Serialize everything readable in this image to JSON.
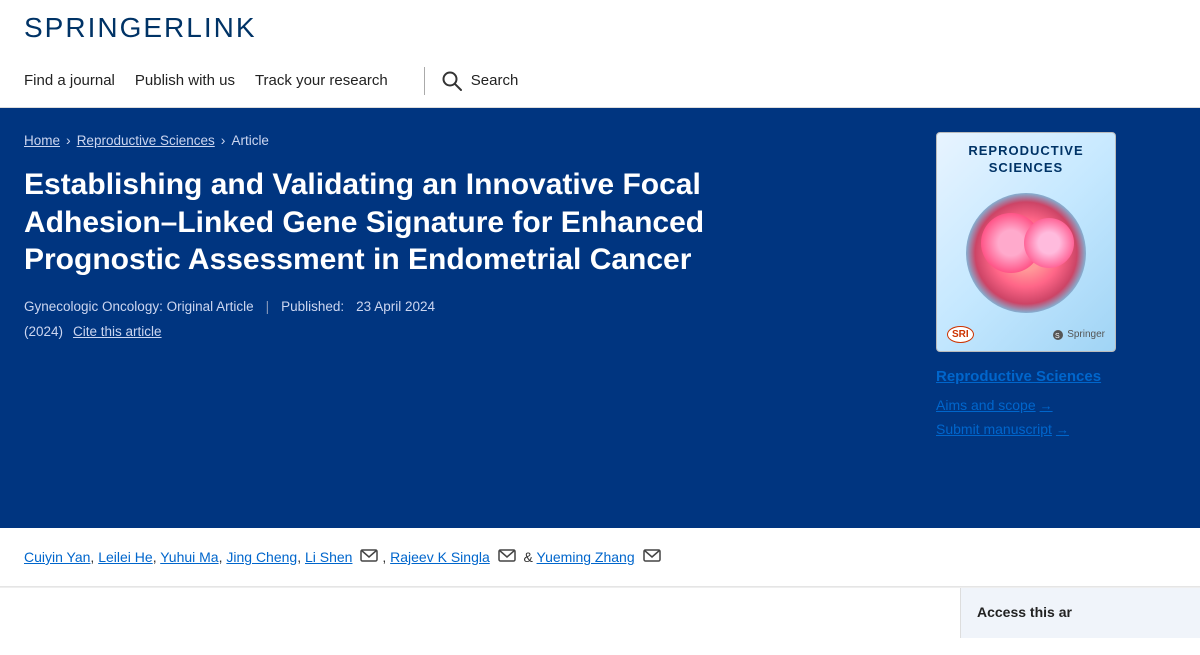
{
  "header": {
    "logo": "SpringerLink",
    "logo_part1": "Springer",
    "logo_part2": "Link",
    "nav": {
      "find_journal": "Find a journal",
      "publish_with_us": "Publish with us",
      "track_research": "Track your research",
      "search": "Search"
    }
  },
  "breadcrumb": {
    "home": "Home",
    "journal": "Reproductive Sciences",
    "section": "Article"
  },
  "article": {
    "title": "Establishing and Validating an Innovative Focal Adhesion–Linked Gene Signature for Enhanced Prognostic Assessment in Endometrial Cancer",
    "article_type": "Gynecologic Oncology: Original Article",
    "published_label": "Published:",
    "published_date": "23 April 2024",
    "year": "(2024)",
    "cite_label": "Cite this article"
  },
  "authors": {
    "list": [
      {
        "name": "Cuiyin Yan",
        "has_email": false
      },
      {
        "name": "Leilei He",
        "has_email": false
      },
      {
        "name": "Yuhui Ma",
        "has_email": false
      },
      {
        "name": "Jing Cheng",
        "has_email": false
      },
      {
        "name": "Li Shen",
        "has_email": true
      },
      {
        "name": "Rajeev K Singla",
        "has_email": true
      },
      {
        "name": "Yueming Zhang",
        "has_email": true
      }
    ],
    "ampersand": "&"
  },
  "sidebar": {
    "journal_name": "Reproductive Sciences",
    "aims_scope": "Aims and scope",
    "submit_manuscript": "Submit manuscript",
    "access_label": "Access this ar",
    "sri_label": "SRI",
    "springer_label": "Springer",
    "cover_title_line1": "Reproductive",
    "cover_title_line2": "Sciences"
  },
  "colors": {
    "hero_bg": "#003580",
    "link_color": "#0066cc",
    "text_light": "#ccd6f0"
  }
}
